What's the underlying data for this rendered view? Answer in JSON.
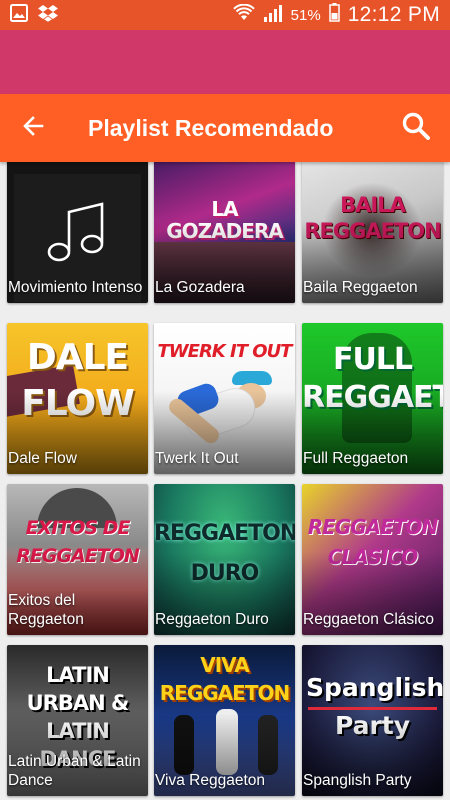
{
  "status_bar": {
    "battery_percent": "51%",
    "time": "12:12 PM",
    "icons": [
      "gallery-icon",
      "dropbox-icon",
      "wifi-icon",
      "signal-icon",
      "battery-icon"
    ]
  },
  "app_bar": {
    "title": "Playlist Recomendado",
    "back_icon": "arrow-left-icon",
    "search_icon": "search-icon"
  },
  "colors": {
    "status_bar": "#e8542a",
    "band": "#d0386a",
    "app_bar": "#ff5e24",
    "background": "#eeeeee"
  },
  "playlists": [
    {
      "label": "Movimiento Intenso",
      "art_text": ""
    },
    {
      "label": "La Gozadera",
      "art_text": "LA GOZADERA"
    },
    {
      "label": "Baila Reggaeton",
      "art_text": "BAILA REGGAETON"
    },
    {
      "label": "Dale Flow",
      "art_text": "DALE FLOW"
    },
    {
      "label": "Twerk It Out",
      "art_text": "TWERK IT OUT"
    },
    {
      "label": "Full Reggaeton",
      "art_text": "FULL REGGAETON"
    },
    {
      "label": "Exitos del Reggaeton",
      "art_text": "EXITOS DE REGGAETON"
    },
    {
      "label": "Reggaeton Duro",
      "art_text": "REGGAETON DURO"
    },
    {
      "label": "Reggaeton Clásico",
      "art_text": "REGGAETON CLASICO"
    },
    {
      "label": "Latin Urban & Latin Dance",
      "art_text": "LATIN URBAN & LATIN DANCE"
    },
    {
      "label": "Viva Reggaeton",
      "art_text": "VIVA REGGAETON"
    },
    {
      "label": "Spanglish Party",
      "art_text": "Spanglish Party"
    }
  ]
}
